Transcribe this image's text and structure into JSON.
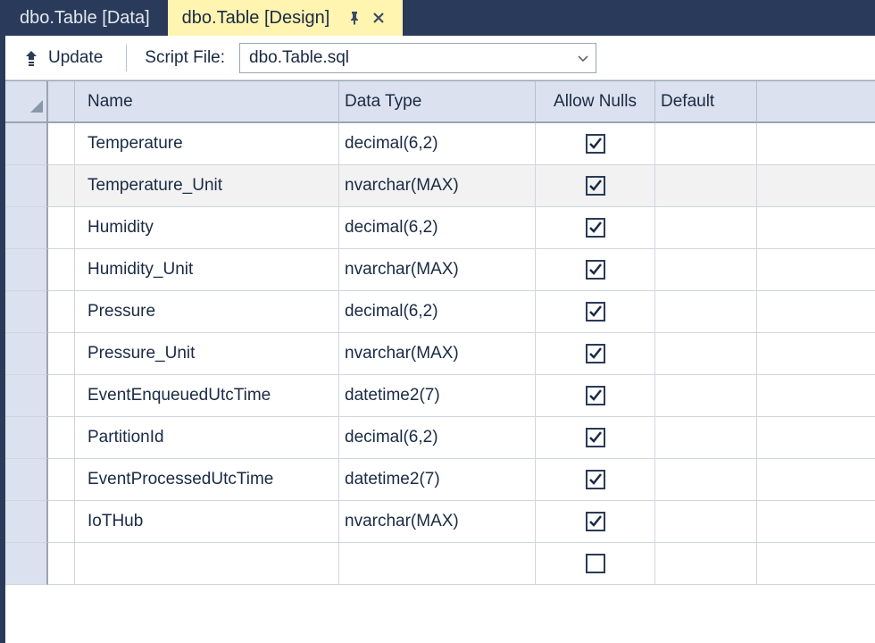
{
  "tabs": [
    {
      "label": "dbo.Table [Data]",
      "active": false
    },
    {
      "label": "dbo.Table [Design]",
      "active": true
    }
  ],
  "toolbar": {
    "update_label": "Update",
    "script_label": "Script File:",
    "script_file": "dbo.Table.sql"
  },
  "columns": {
    "name": "Name",
    "data_type": "Data Type",
    "allow_nulls": "Allow Nulls",
    "default": "Default"
  },
  "rows": [
    {
      "name": "Temperature",
      "data_type": "decimal(6,2)",
      "allow_nulls": true,
      "default": "",
      "selected": false
    },
    {
      "name": "Temperature_Unit",
      "data_type": "nvarchar(MAX)",
      "allow_nulls": true,
      "default": "",
      "selected": true
    },
    {
      "name": "Humidity",
      "data_type": "decimal(6,2)",
      "allow_nulls": true,
      "default": "",
      "selected": false
    },
    {
      "name": "Humidity_Unit",
      "data_type": "nvarchar(MAX)",
      "allow_nulls": true,
      "default": "",
      "selected": false
    },
    {
      "name": "Pressure",
      "data_type": "decimal(6,2)",
      "allow_nulls": true,
      "default": "",
      "selected": false
    },
    {
      "name": "Pressure_Unit",
      "data_type": "nvarchar(MAX)",
      "allow_nulls": true,
      "default": "",
      "selected": false
    },
    {
      "name": "EventEnqueuedUtcTime",
      "data_type": "datetime2(7)",
      "allow_nulls": true,
      "default": "",
      "selected": false
    },
    {
      "name": "PartitionId",
      "data_type": "decimal(6,2)",
      "allow_nulls": true,
      "default": "",
      "selected": false
    },
    {
      "name": "EventProcessedUtcTime",
      "data_type": "datetime2(7)",
      "allow_nulls": true,
      "default": "",
      "selected": false
    },
    {
      "name": "IoTHub",
      "data_type": "nvarchar(MAX)",
      "allow_nulls": true,
      "default": "",
      "selected": false
    },
    {
      "name": "",
      "data_type": "",
      "allow_nulls": false,
      "default": "",
      "selected": false
    }
  ]
}
